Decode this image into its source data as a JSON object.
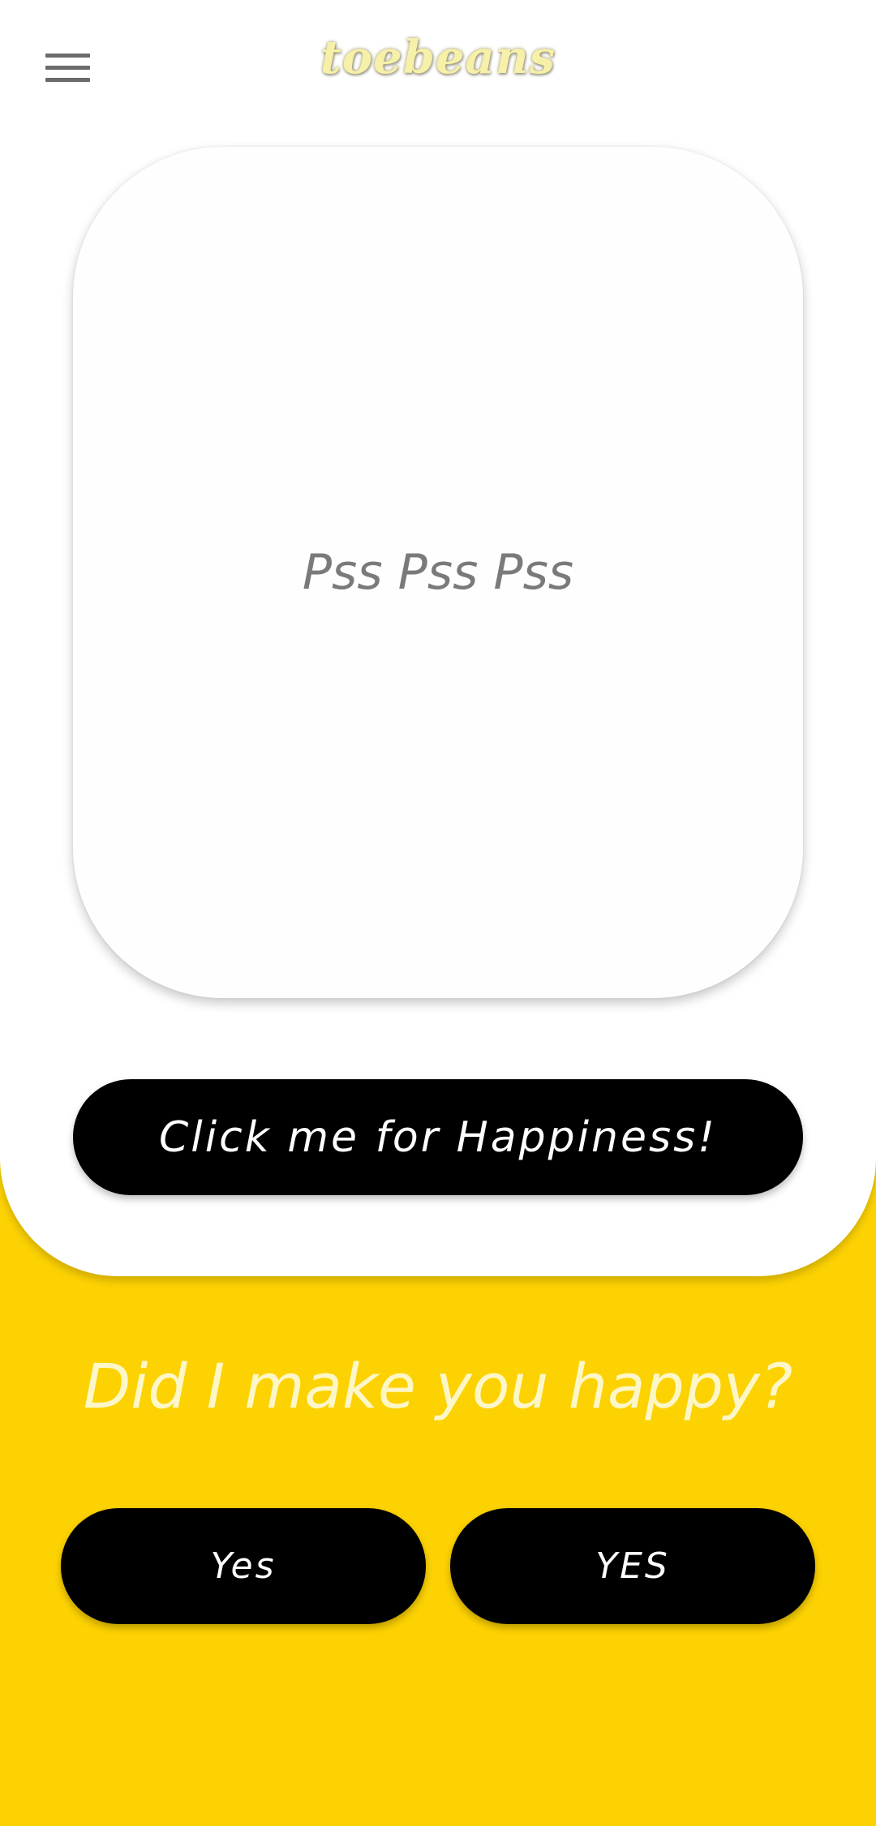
{
  "header": {
    "menu_icon": "hamburger-menu-icon",
    "title": "toebeans"
  },
  "card": {
    "text": "Pss Pss Pss"
  },
  "happiness_button": {
    "label": "Click me for Happiness!"
  },
  "feedback": {
    "question": "Did I make you happy?",
    "yes_label": "Yes",
    "yes_caps_label": "YES"
  },
  "colors": {
    "background_yellow": "#FDD202",
    "panel_white": "#FFFFFF",
    "button_black": "#000000",
    "question_text": "#FDF7C8"
  }
}
